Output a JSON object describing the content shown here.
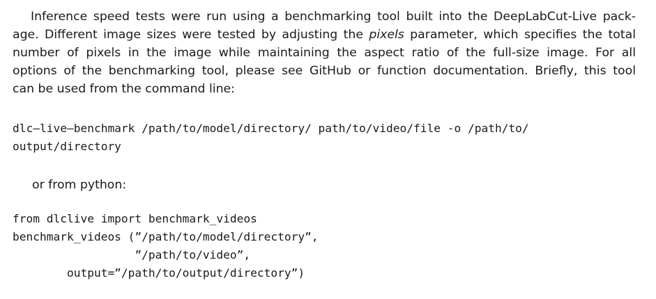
{
  "paragraph": {
    "line1_a": "Inference speed tests were run using a benchmarking tool built into the DeepLabCut-Live pack-",
    "line2_a": "age. Different image sizes were tested by adjusting the ",
    "line2_em": "pixels",
    "line2_b": " parameter, which specifies the total",
    "line3": "number of pixels in the image while maintaining the aspect ratio of the full-size image. For all",
    "line4": "options of the benchmarking tool, please see GitHub or function documentation. Briefly, this tool",
    "line5": "can be used from the command line:"
  },
  "cli_code": {
    "line1": "dlc—live—benchmark /path/to/model/directory/ path/to/video/file -o /path/to/",
    "line2": "output/directory"
  },
  "python_intro": "or from python:",
  "python_code": {
    "line1": "from dlclive import benchmark_videos",
    "line2": "benchmark_videos (”/path/to/model/directory”,",
    "line3": "                  ”/path/to/video”,",
    "line4": "        output=”/path/to/output/directory”)"
  }
}
